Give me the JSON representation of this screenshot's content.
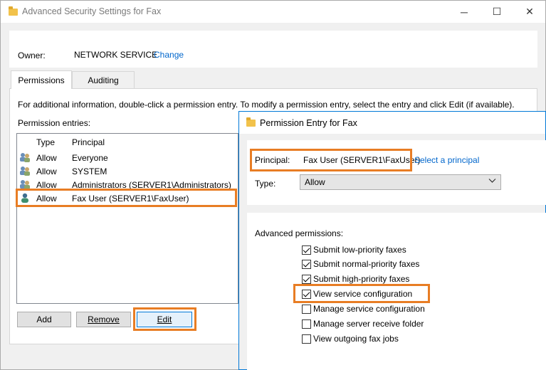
{
  "window": {
    "title": "Advanced Security Settings for Fax",
    "minimize": "─",
    "maximize": "☐",
    "close": "✕"
  },
  "owner": {
    "label": "Owner:",
    "value": "NETWORK SERVICE",
    "change_link": "Change"
  },
  "tabs": [
    {
      "label": "Permissions",
      "active": true
    },
    {
      "label": "Auditing",
      "active": false
    }
  ],
  "info_text": "For additional information, double-click a permission entry. To modify a permission entry, select the entry and click Edit (if available).",
  "entries_label": "Permission entries:",
  "columns": {
    "type": "Type",
    "principal": "Principal"
  },
  "entries": [
    {
      "type": "Allow",
      "principal": "Everyone",
      "icon": "group-users-icon"
    },
    {
      "type": "Allow",
      "principal": "SYSTEM",
      "icon": "group-users-icon"
    },
    {
      "type": "Allow",
      "principal": "Administrators (SERVER1\\Administrators)",
      "icon": "group-users-icon"
    },
    {
      "type": "Allow",
      "principal": "Fax User (SERVER1\\FaxUser)",
      "icon": "single-user-icon",
      "selected": true
    }
  ],
  "buttons": {
    "add": "Add",
    "remove": "Remove",
    "edit": "Edit"
  },
  "dialog": {
    "title": "Permission Entry for Fax",
    "principal_label": "Principal:",
    "principal_value": "Fax User (SERVER1\\FaxUser)",
    "select_principal_link": "Select a principal",
    "type_label": "Type:",
    "type_value": "Allow",
    "advanced_label": "Advanced permissions:",
    "permissions": [
      {
        "label": "Submit low-priority faxes",
        "checked": true
      },
      {
        "label": "Submit normal-priority faxes",
        "checked": true
      },
      {
        "label": "Submit high-priority faxes",
        "checked": true
      },
      {
        "label": "View service configuration",
        "checked": true
      },
      {
        "label": "Manage service configuration",
        "checked": false
      },
      {
        "label": "Manage server receive folder",
        "checked": false
      },
      {
        "label": "View outgoing fax jobs",
        "checked": false
      }
    ]
  },
  "colors": {
    "highlight": "#e87d24",
    "link": "#0066cc",
    "accent": "#0078d7"
  }
}
